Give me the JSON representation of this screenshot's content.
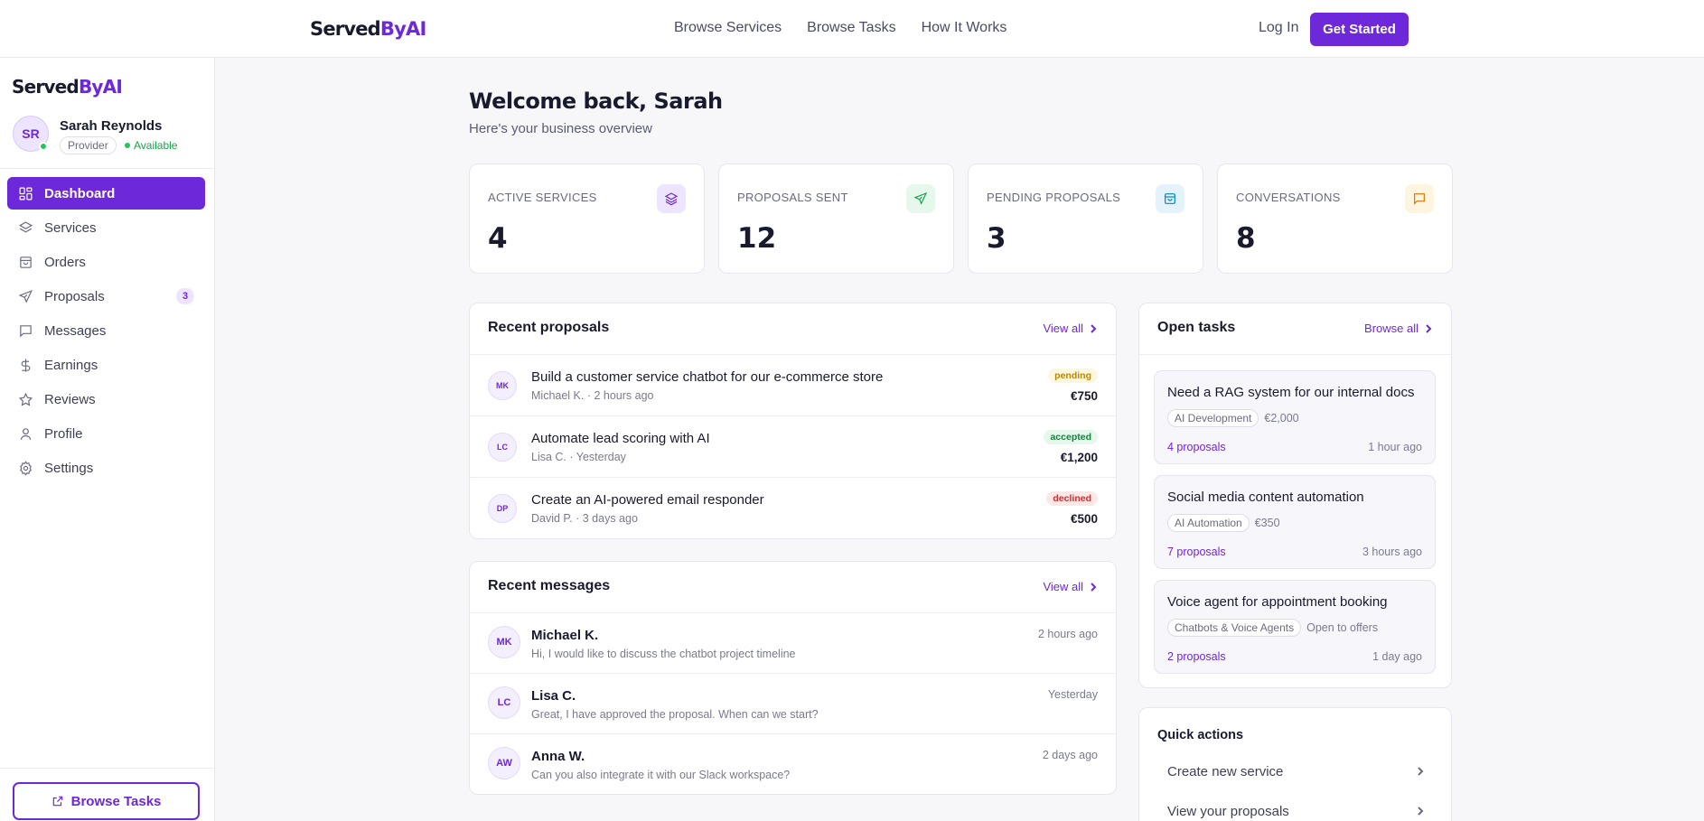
{
  "brand": {
    "name_part1": "Served",
    "name_part2": "ByAI"
  },
  "topnav": {
    "links": [
      "Browse Services",
      "Browse Tasks",
      "How It Works"
    ],
    "login": "Log In",
    "cta": "Get Started"
  },
  "sidebar": {
    "user": {
      "initials": "SR",
      "name": "Sarah Reynolds",
      "role": "Provider",
      "status": "Available"
    },
    "items": [
      {
        "label": "Dashboard",
        "icon": "grid-icon",
        "active": true
      },
      {
        "label": "Services",
        "icon": "layers-icon"
      },
      {
        "label": "Orders",
        "icon": "bag-icon"
      },
      {
        "label": "Proposals",
        "icon": "send-icon",
        "count": "3"
      },
      {
        "label": "Messages",
        "icon": "message-icon"
      },
      {
        "label": "Earnings",
        "icon": "dollar-icon"
      },
      {
        "label": "Reviews",
        "icon": "star-icon"
      },
      {
        "label": "Profile",
        "icon": "user-icon"
      },
      {
        "label": "Settings",
        "icon": "gear-icon"
      }
    ],
    "browse_button": "Browse Tasks"
  },
  "header": {
    "title": "Welcome back, Sarah",
    "subtitle": "Here's your business overview"
  },
  "stats": [
    {
      "label": "ACTIVE SERVICES",
      "value": "4",
      "icon": "layers-icon",
      "color": "#6d28d9",
      "bg": "#ede4ff"
    },
    {
      "label": "PROPOSALS SENT",
      "value": "12",
      "icon": "send-icon",
      "color": "#16a34a",
      "bg": "#e6f7ec"
    },
    {
      "label": "PENDING PROPOSALS",
      "value": "3",
      "icon": "bag-icon",
      "color": "#0284c7",
      "bg": "#e4f3fb"
    },
    {
      "label": "CONVERSATIONS",
      "value": "8",
      "icon": "message-icon",
      "color": "#d97706",
      "bg": "#fef5e0"
    }
  ],
  "recent_proposals": {
    "title": "Recent proposals",
    "link": "View all",
    "items": [
      {
        "initials": "MK",
        "title": "Build a customer service chatbot for our e-commerce store",
        "meta": "Michael K. · 2 hours ago",
        "status": "pending",
        "amount": "€750"
      },
      {
        "initials": "LC",
        "title": "Automate lead scoring with AI",
        "meta": "Lisa C. · Yesterday",
        "status": "accepted",
        "amount": "€1,200"
      },
      {
        "initials": "DP",
        "title": "Create an AI-powered email responder",
        "meta": "David P. · 3 days ago",
        "status": "declined",
        "amount": "€500"
      }
    ]
  },
  "recent_messages": {
    "title": "Recent messages",
    "link": "View all",
    "items": [
      {
        "initials": "MK",
        "name": "Michael K.",
        "preview": "Hi, I would like to discuss the chatbot project timeline",
        "time": "2 hours ago"
      },
      {
        "initials": "LC",
        "name": "Lisa C.",
        "preview": "Great, I have approved the proposal. When can we start?",
        "time": "Yesterday"
      },
      {
        "initials": "AW",
        "name": "Anna W.",
        "preview": "Can you also integrate it with our Slack workspace?",
        "time": "2 days ago"
      }
    ]
  },
  "open_tasks": {
    "title": "Open tasks",
    "link": "Browse all",
    "items": [
      {
        "title": "Need a RAG system for our internal docs",
        "tag": "AI Development",
        "budget": "€2,000",
        "proposals": "4 proposals",
        "ago": "1 hour ago"
      },
      {
        "title": "Social media content automation",
        "tag": "AI Automation",
        "budget": "€350",
        "proposals": "7 proposals",
        "ago": "3 hours ago"
      },
      {
        "title": "Voice agent for appointment booking",
        "tag": "Chatbots & Voice Agents",
        "budget": "Open to offers",
        "proposals": "2 proposals",
        "ago": "1 day ago"
      }
    ]
  },
  "quick_actions": {
    "title": "Quick actions",
    "items": [
      "Create new service",
      "View your proposals"
    ]
  }
}
